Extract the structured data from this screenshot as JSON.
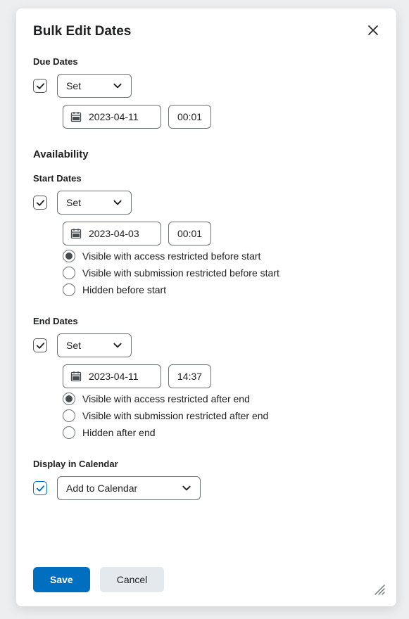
{
  "dialog": {
    "title": "Bulk Edit Dates"
  },
  "dueDates": {
    "label": "Due Dates",
    "select": "Set",
    "date": "2023-04-11",
    "time": "00:01"
  },
  "availability": {
    "heading": "Availability"
  },
  "startDates": {
    "label": "Start Dates",
    "select": "Set",
    "date": "2023-04-03",
    "time": "00:01",
    "radios": {
      "r1": "Visible with access restricted before start",
      "r2": "Visible with submission restricted before start",
      "r3": "Hidden before start"
    }
  },
  "endDates": {
    "label": "End Dates",
    "select": "Set",
    "date": "2023-04-11",
    "time": "14:37",
    "radios": {
      "r1": "Visible with access restricted after end",
      "r2": "Visible with submission restricted after end",
      "r3": "Hidden after end"
    }
  },
  "displayInCalendar": {
    "label": "Display in Calendar",
    "select": "Add to Calendar"
  },
  "buttons": {
    "save": "Save",
    "cancel": "Cancel"
  }
}
